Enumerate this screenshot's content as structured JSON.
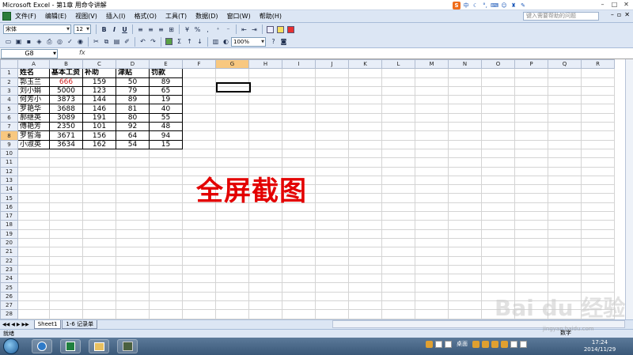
{
  "window": {
    "title": "Microsoft Excel - 第1章 用命令讲解"
  },
  "ime": {
    "label": "中"
  },
  "menu": {
    "items": [
      "文件(F)",
      "编辑(E)",
      "视图(V)",
      "插入(I)",
      "格式(O)",
      "工具(T)",
      "数据(D)",
      "窗口(W)",
      "帮助(H)"
    ]
  },
  "help_placeholder": "键入需要帮助的问题",
  "toolbar": {
    "font": "宋体",
    "size": "12",
    "bold": "B",
    "italic": "I",
    "underline": "U",
    "percent": "%",
    "comma": ",",
    "sigma": "Σ",
    "zoom": "100%"
  },
  "formula_bar": {
    "name_box": "G8",
    "fx": "fx",
    "value": ""
  },
  "sheet": {
    "columns": [
      "A",
      "B",
      "C",
      "D",
      "E",
      "F",
      "G",
      "H",
      "I",
      "J",
      "K",
      "L",
      "M",
      "N",
      "O",
      "P",
      "Q",
      "R"
    ],
    "row_count": 28,
    "selected_row": 8,
    "selected_col": "G",
    "headers": [
      "姓名",
      "基本工资",
      "补助",
      "津贴",
      "罚款"
    ],
    "rows": [
      [
        "郭玉兰",
        "666",
        "159",
        "50",
        "89"
      ],
      [
        "刘小娟",
        "5000",
        "123",
        "79",
        "65"
      ],
      [
        "何芳小",
        "3873",
        "144",
        "89",
        "19"
      ],
      [
        "罗艳华",
        "3688",
        "146",
        "81",
        "40"
      ],
      [
        "郝继英",
        "3089",
        "191",
        "80",
        "55"
      ],
      [
        "傅艳芳",
        "2350",
        "101",
        "92",
        "48"
      ],
      [
        "罗皙海",
        "3671",
        "156",
        "64",
        "94"
      ],
      [
        "小淑英",
        "3634",
        "162",
        "54",
        "15"
      ]
    ]
  },
  "overlay_text": "全屏截图",
  "tabs": [
    "Sheet1",
    "1-6 记录单"
  ],
  "status": {
    "ready": "就绪",
    "mode": "数字"
  },
  "taskbar": {
    "desktop": "桌面",
    "time": "17:24",
    "date": "2014/11/29"
  },
  "watermark": {
    "logo": "Bai du 经验",
    "url": "jingyan.baidu.com"
  }
}
